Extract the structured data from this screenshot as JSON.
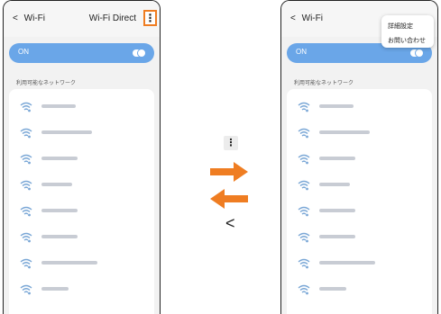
{
  "left_screen": {
    "back_label": "Wi-Fi",
    "title": "Wi-Fi Direct",
    "on_label": "ON",
    "section_header": "利用可能なネットワーク"
  },
  "right_screen": {
    "back_label": "Wi-Fi",
    "on_label": "ON",
    "section_header": "利用可能なネットワーク",
    "menu_items": [
      "詳細設定",
      "お問い合わせ"
    ]
  },
  "middle": {
    "back_glyph": "<",
    "arrow_color": "#ef7d22"
  },
  "colors": {
    "accent_highlight": "#ef7d22",
    "on_bar": "#6aa6e8"
  },
  "icons": [
    "chevron-left-icon",
    "more-vert-icon",
    "wifi-icon",
    "arrow-right-icon",
    "arrow-left-icon"
  ]
}
